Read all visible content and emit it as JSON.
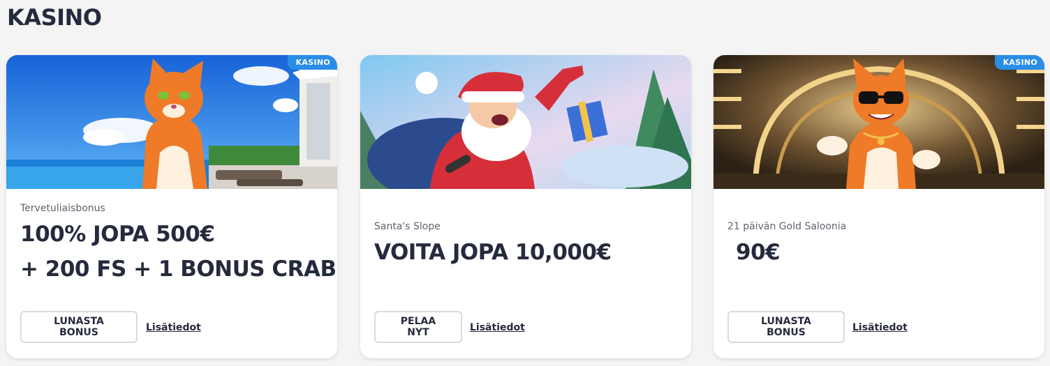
{
  "section": {
    "title": "KASINO"
  },
  "colors": {
    "badge": "#2a8ee6",
    "text": "#252a3d",
    "background": "#f4f4f4"
  },
  "cards": [
    {
      "badge": "KASINO",
      "image": "orange-cat-pool-villa-image",
      "subtitle": "Tervetuliaisbonus",
      "headline_lines": [
        "100% JOPA 500€",
        "+ 200 FS + 1 BONUS CRAB"
      ],
      "button_label": "LUNASTA BONUS",
      "link_label": "Lisätiedot"
    },
    {
      "image": "santa-with-gift-image",
      "subtitle": "Santa's Slope",
      "headline_lines": [
        "VOITA JOPA 10,000€"
      ],
      "button_label": "PELAA NYT",
      "link_label": "Lisätiedot"
    },
    {
      "badge": "KASINO",
      "image": "cat-sunglasses-saloon-image",
      "subtitle": "21 päivän Gold Saloonia",
      "headline_lines": [
        "90€"
      ],
      "button_label": "LUNASTA BONUS",
      "link_label": "Lisätiedot"
    }
  ]
}
